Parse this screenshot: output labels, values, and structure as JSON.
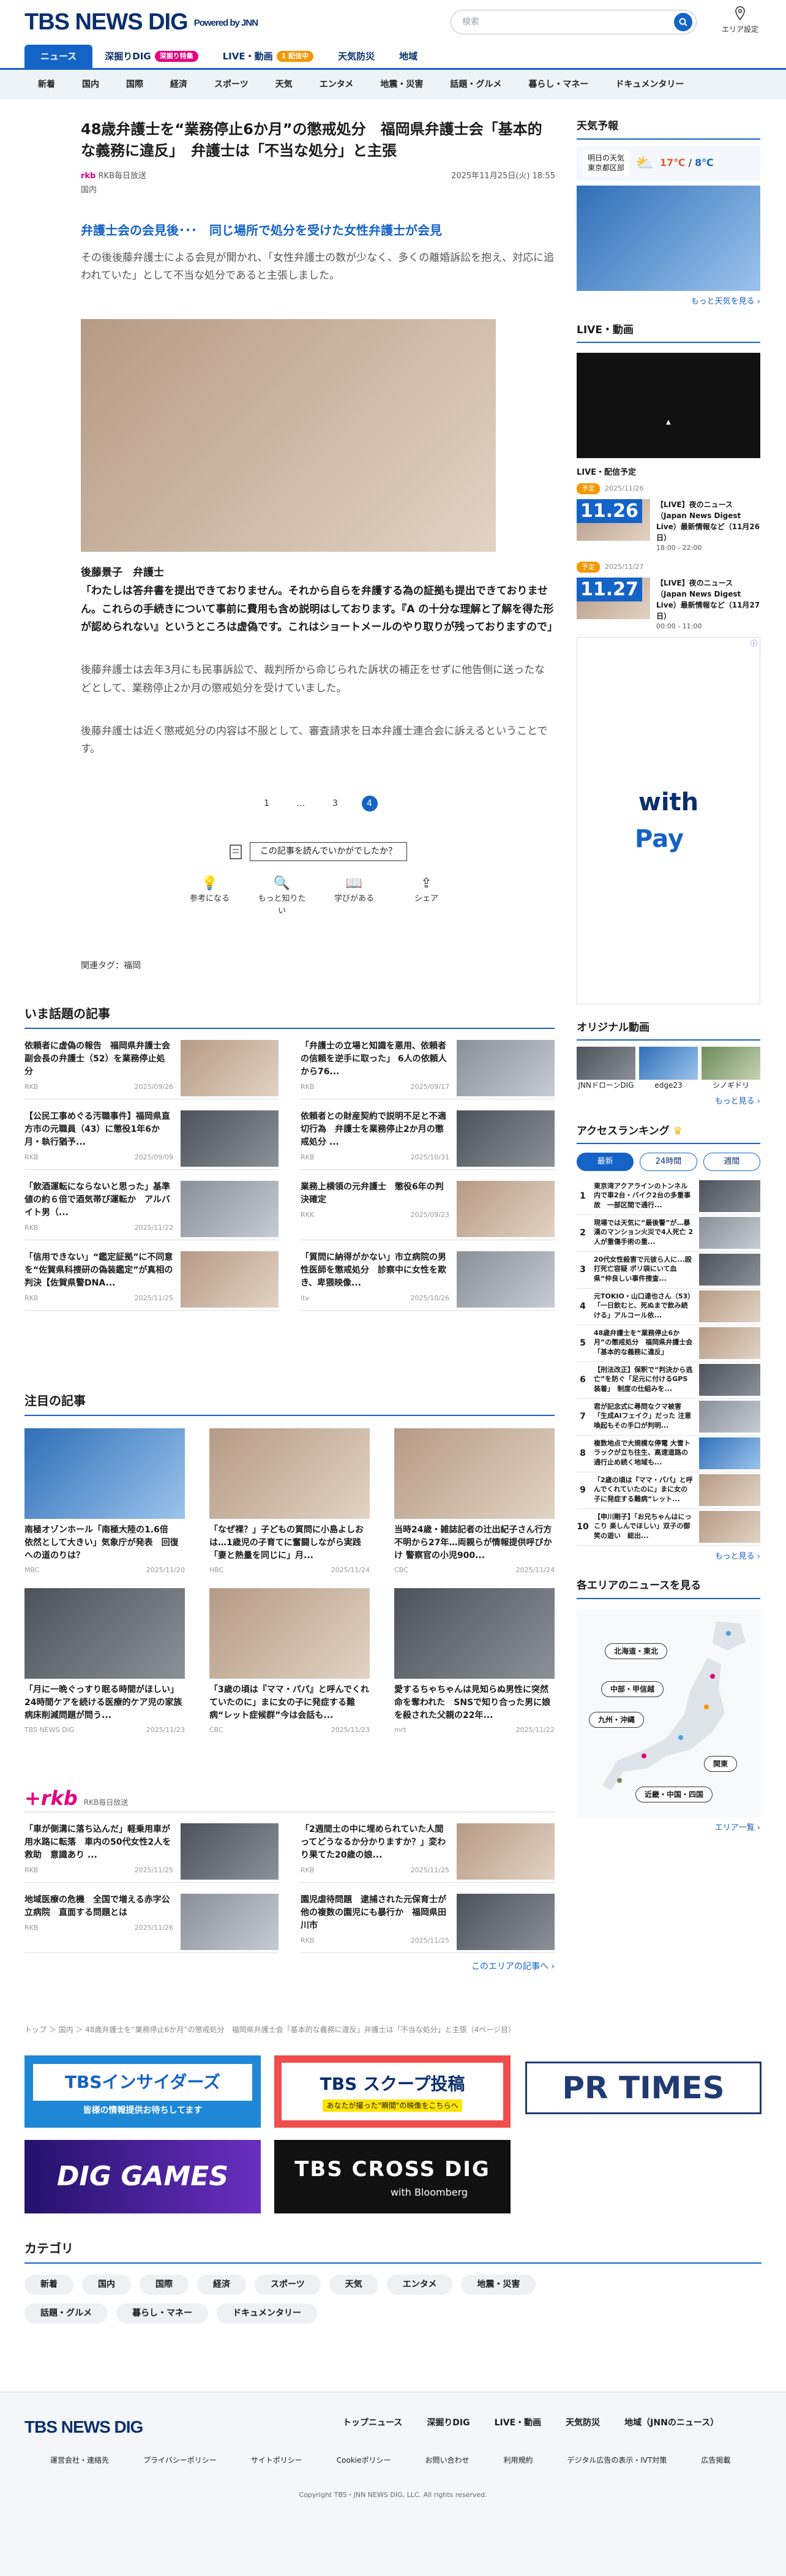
{
  "header": {
    "logo": "TBS NEWS DIG",
    "powered": "Powered by JNN",
    "search_placeholder": "検索",
    "area_label": "エリア設定"
  },
  "nav": [
    {
      "label": "ニュース",
      "active": true
    },
    {
      "label": "深掘りDIG",
      "badge": "深掘り特集",
      "badge_color": "#e3007f"
    },
    {
      "label": "LIVE・動画",
      "badge": "1 配信中",
      "badge_color": "#f39800"
    },
    {
      "label": "天気防災"
    },
    {
      "label": "地域"
    }
  ],
  "categories": [
    "新着",
    "国内",
    "国際",
    "経済",
    "スポーツ",
    "天気",
    "エンタメ",
    "地震・災害",
    "話題・グルメ",
    "暮らし・マネー",
    "ドキュメンタリー"
  ],
  "article": {
    "title": "48歳弁護士を“業務停止6か月”の懲戒処分　福岡県弁護士会「基本的な義務に違反」　弁護士は「不当な処分」と主張",
    "source": "RKB毎日放送",
    "date": "2025年11月25日(火) 18:55",
    "tag": "国内",
    "lead": "弁護士会の会見後･･･　同じ場所で処分を受けた女性弁護士が会見",
    "para1": "その後後藤弁護士による会見が開かれ、「女性弁護士の数が少なく、多くの離婚訴訟を抱え、対応に追われていた」として不当な処分であると主張しました。",
    "caption_name": "後藤景子　弁護士",
    "quote": "「わたしは答弁書を提出できておりません。それから自らを弁護する為の証拠も提出できておりません。これらの手続きについて事前に費用も含め説明はしております。『A の十分な理解と了解を得た形が認められない』というところは虚偽です。これはショートメールのやり取りが残っておりますので」",
    "para2": "後藤弁護士は去年3月にも民事訴訟で、裁判所から命じられた訴状の補正をせずに他告側に送ったなどとして、業務停止2か月の懲戒処分を受けていました。",
    "para3": "後藤弁護士は近く懲戒処分の内容は不服として、審査請求を日本弁護士連合会に訴えるということです。",
    "pages": [
      "1",
      "...",
      "3",
      "4"
    ],
    "current_page": "4",
    "survey": "この記事を読んでいかがでしたか？",
    "reactions": [
      {
        "icon": "lightbulb-icon",
        "glyph": "♀",
        "label": "参考になる"
      },
      {
        "icon": "question-icon",
        "glyph": "?",
        "label": "もっと知りたい"
      },
      {
        "icon": "book-icon",
        "glyph": "▢",
        "label": "学びがある"
      },
      {
        "icon": "share-icon",
        "glyph": "⇪",
        "label": "シェア"
      }
    ],
    "related_tags": "関連タグ：福岡"
  },
  "trending": {
    "title": "いま話題の記事",
    "items": [
      {
        "title": "依頼者に虚偽の報告　福岡県弁護士会副会長の弁護士（52）を業務停止処分",
        "src": "RKB",
        "date": "2025/09/26"
      },
      {
        "title": "「弁護士の立場と知識を悪用、依頼者の信頼を逆手に取った」 6人の依頼人から76...",
        "src": "RKB",
        "date": "2025/09/17"
      },
      {
        "title": "【公民工事めぐる汚職事件】福岡県直方市の元職員（43）に懲役1年6か月・執行猶予...",
        "src": "RKB",
        "date": "2025/09/09"
      },
      {
        "title": "依頼者との財産契約で説明不足と不適切行為　弁護士を業務停止2か月の懲戒処分 ...",
        "src": "RKB",
        "date": "2025/10/31"
      },
      {
        "title": "「飲酒運転にならないと思った」基準値の約６倍で酒気帯び運転か　アルバイト男（...",
        "src": "RKB",
        "date": "2025/11/22"
      },
      {
        "title": "業務上横領の元弁護士　懲役6年の判決確定",
        "src": "RKK",
        "date": "2025/09/23"
      },
      {
        "title": "「信用できない」“鑑定証拠”に不同意を“佐賀県科捜研の偽装鑑定”が真相の判決【佐賀県警DNA...",
        "src": "RKB",
        "date": "2025/11/25"
      },
      {
        "title": "「質問に納得がかない」市立病院の男性医師を懲戒処分　診察中に女性を欺き、卑猥映像...",
        "src": "itv",
        "date": "2025/10/26"
      }
    ]
  },
  "featured": {
    "title": "注目の記事",
    "items": [
      {
        "title": "南極オゾンホール「南極大陸の1.6倍　依然として大きい」気象庁が発表　回復への道のりは？",
        "src": "MBC",
        "date": "2025/11/20"
      },
      {
        "title": "「なぜ裸？」子どもの質問に小島よしおは…1歳児の子育てに奮闘しながら実践「妻と熱量を同じに」月...",
        "src": "HBC",
        "date": "2025/11/24"
      },
      {
        "title": "当時24歳・雑誌記者の辻出紀子さん行方不明から27年…両親らが情報提供呼びかけ 警察官の小児900...",
        "src": "CBC",
        "date": "2025/11/24"
      },
      {
        "title": "「月に一晩ぐっすり眠る時間がほしい」24時間ケアを続ける医療的ケア児の家族　病床削減問題が問う...",
        "src": "TBS NEWS DIG",
        "date": "2025/11/23"
      },
      {
        "title": "「3歳の頃は『ママ・パパ』と呼んでくれていたのに」まに女の子に発症する難病“レット症候群”今は会話も...",
        "src": "CBC",
        "date": "2025/11/23"
      },
      {
        "title": "愛するちゃちゃんは見知らぬ男性に突然命を奪われた　SNSで知り合った男に娘を殺された父親の22年...",
        "src": "mrt",
        "date": "2025/11/22"
      }
    ]
  },
  "local": {
    "title": "RKB毎日放送",
    "items": [
      {
        "title": "「車が側溝に落ち込んだ」軽乗用車が用水路に転落　車内の50代女性2人を救助　意識あり ...",
        "src": "RKB",
        "date": "2025/11/25"
      },
      {
        "title": "「2週間土の中に埋められていた人間ってどうなるか分かりますか？」変わり果てた20歳の娘...",
        "src": "RKB",
        "date": "2025/11/25"
      },
      {
        "title": "地域医療の危機　全国で増える赤字公立病院　直面する問題とは",
        "src": "RKB",
        "date": "2025/11/26"
      },
      {
        "title": "園児虐待問題　逮捕された元保育士が他の複数の園児にも暴行か　福岡県田川市",
        "src": "RKB",
        "date": "2025/11/25"
      }
    ],
    "more": "このエリアの記事へ ›"
  },
  "breadcrumb": "トップ ＞ 国内 ＞ 48歳弁護士を“業務停止6か月”の懲戒処分　福岡県弁護士会「基本的な義務に違反」弁護士は「不当な処分」と主張（4ページ目）",
  "banners": [
    {
      "label": "TBSインサイダーズ",
      "sub": "皆様の情報提供お待ちしてます"
    },
    {
      "label": "TBS スクープ投稿",
      "sub": "あなたが撮った\"瞬間\"の映像をこちらへ"
    },
    {
      "label": "PR TIMES"
    },
    {
      "label": "DIG GAMES"
    },
    {
      "label": "TBS CROSS DIG",
      "sub": "with Bloomberg"
    }
  ],
  "category_block": {
    "title": "カテゴリ",
    "items": [
      "新着",
      "国内",
      "国際",
      "経済",
      "スポーツ",
      "天気",
      "エンタメ",
      "地震・災害",
      "話題・グルメ",
      "暮らし・マネー",
      "ドキュメンタリー"
    ]
  },
  "sidebar": {
    "weather_title": "天気予報",
    "weather_day": "明日の天気",
    "weather_area": "東京都区部",
    "weather_temp_hi": "17℃",
    "weather_temp_lo": "8℃",
    "weather_more": "もっと天気を見る ›",
    "live_title": "LIVE・動画",
    "live_schedule": "LIVE・配信予定",
    "schedule": [
      {
        "tag": "予定",
        "date": "2025/11/26",
        "day": "11.26",
        "title": "【LIVE】夜のニュース（Japan News Digest Live）最新情報など（11月26日）",
        "time": "18:00 - 22:00"
      },
      {
        "tag": "予定",
        "date": "2025/11/27",
        "day": "11.27",
        "title": "【LIVE】夜のニュース（Japan News Digest Live）最新情報など（11月27日）",
        "time": "00:00 - 11:00"
      }
    ],
    "ad_text1": "with",
    "ad_text2": "Pay",
    "orig_title": "オリジナル動画",
    "orig": [
      {
        "label": "JNNドローンDIG"
      },
      {
        "label": "edge23"
      },
      {
        "label": "シノギドリ"
      }
    ],
    "orig_more": "もっと見る ›",
    "rank_title": "アクセスランキング",
    "rank_tabs": [
      "最新",
      "24時間",
      "週間"
    ],
    "ranking": [
      "東京湾アクアラインのトンネル内で車2台・バイク2台の多重事故　一部区間で通行...",
      "現場では天気に“最後警”が…暴漢のマンション火災で4人死亡 2人が重傷手術の重...",
      "20代女性殺害で元彼ら人に...殴打死亡容疑 ポリ袋にいて血 県“仲良しい事件捜査...",
      "元TOKIO・山口達也さん（53）　「一日飲むと、死ぬまで飲み続ける」アルコール依...",
      "48歳弁護士を“業務停止6か月”の懲戒処分　福岡県弁護士会「基本的な義務に違反」",
      "【刑法改正】保釈で“判決から逃亡”を防ぐ「足元に付けるGPS装着」　制度の仕組みを...",
      "君が記念式に尋問なクマ被害「生成AIフェイク」だった 注意喚起もその手口が判明...",
      "複数地点で大規模な停電 大雪トラックが立ち往生、高速道路の通行止め続く地域も...",
      "「2歳の頃は『ママ・パパ』と呼んでくれていたのに」まに女の子に発症する難病“レット...",
      "【申川剛子】「お兄ちゃんはにっこり 楽しんでほしい」双子の御笑の遊い　総出..."
    ],
    "rank_more": "もっと見る ›",
    "area_title": "各エリアのニュースを見る",
    "areas": [
      "北海道・東北",
      "中部・甲信越",
      "九州・沖縄",
      "関東",
      "近畿・中国・四国"
    ],
    "area_more": "エリア一覧 ›"
  },
  "footer": {
    "logo": "TBS NEWS DIG",
    "nav": [
      "トップニュース",
      "深掘りDIG",
      "LIVE・動画",
      "天気防災",
      "地域（JNNのニュース）"
    ],
    "links": [
      "運営会社・連絡先",
      "プライバシーポリシー",
      "サイトポリシー",
      "Cookieポリシー",
      "お問い合わせ",
      "利用規約",
      "デジタル広告の表示・IVT対策",
      "広告掲載"
    ],
    "copyright": "Copyright TBS・JNN NEWS DIG, LLC. All rights reserved."
  },
  "colors": {
    "brand": "#1463c6",
    "navy": "#0a2f6e",
    "accent_pink": "#e3007f",
    "accent_orange": "#f39800"
  }
}
